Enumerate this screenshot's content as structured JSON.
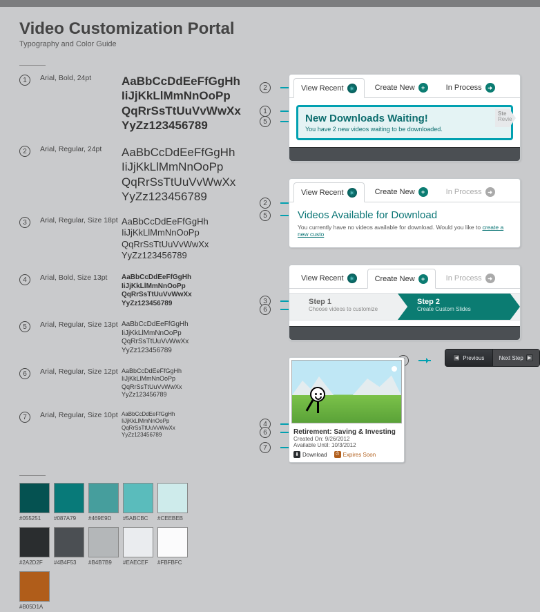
{
  "header": {
    "title": "Video Customization Portal",
    "subtitle": "Typography and Color Guide"
  },
  "type_specs": [
    {
      "n": "1",
      "label": "Arial, Bold, 24pt",
      "cls": "s1",
      "sample": "AaBbCcDdEeFfGgHh IiJjKkLlMmNnOoPp QqRrSsTtUuVvWwXx YyZz123456789"
    },
    {
      "n": "2",
      "label": "Arial, Regular, 24pt",
      "cls": "s2",
      "sample": "AaBbCcDdEeFfGgHh IiJjKkLlMmNnOoPp QqRrSsTtUuVvWwXx YyZz123456789"
    },
    {
      "n": "3",
      "label": "Arial, Regular, Size 18pt",
      "cls": "s3",
      "sample": "AaBbCcDdEeFfGgHh IiJjKkLlMmNnOoPp QqRrSsTtUuVvWwXx YyZz123456789"
    },
    {
      "n": "4",
      "label": "Arial, Bold, Size 13pt",
      "cls": "s4",
      "sample": "AaBbCcDdEeFfGgHh IiJjKkLlMmNnOoPp QqRrSsTtUuVvWwXx YyZz123456789"
    },
    {
      "n": "5",
      "label": "Arial, Regular, Size 13pt",
      "cls": "s5",
      "sample": "AaBbCcDdEeFfGgHh IiJjKkLlMmNnOoPp QqRrSsTtUuVvWwXx YyZz123456789"
    },
    {
      "n": "6",
      "label": "Arial, Regular, Size 12pt",
      "cls": "s6",
      "sample": "AaBbCcDdEeFfGgHh IiJjKkLlMmNnOoPp QqRrSsTtUuVvWwXx YyZz123456789"
    },
    {
      "n": "7",
      "label": "Arial, Regular, Size 10pt",
      "cls": "s7",
      "sample": "AaBbCcDdEeFfGgHh IiJjKkLlMmNnOoPp QqRrSsTtUuVvWwXx YyZz123456789"
    }
  ],
  "tabs": {
    "recent": "View Recent",
    "create": "Create New",
    "process": "In Process"
  },
  "plus": "+",
  "notify": {
    "title": "New Downloads Waiting!",
    "desc": "You have 2 new videos waiting to be downloaded.",
    "close": "✕"
  },
  "step_ghost": "Ste",
  "step_ghost2": "Revie",
  "panel2": {
    "heading": "Videos Available for Download",
    "desc": "You currently have no videos available for download.  Would you like to ",
    "link": "create a new custo"
  },
  "steps": {
    "s1t": "Step 1",
    "s1d": "Choose videos to customize",
    "s2t": "Step 2",
    "s2d": "Create Custom Slides"
  },
  "card": {
    "title": "Retirement: Saving & Investing",
    "created": "Created On: 9/26/2012",
    "expires": "Available Until: 10/3/2012",
    "download": "Download",
    "expires_soon": "Expires Soon",
    "dl_icon": "⬇",
    "ex_icon": "⏱"
  },
  "pager": {
    "prev": "Previous",
    "next": "Next Step",
    "prev_icon": "◀",
    "next_icon": "▶"
  },
  "swatches": [
    [
      "#055251",
      "#087A79",
      "#469E9D",
      "#5ABCBC",
      "#CEEBEB"
    ],
    [
      "#2A2D2F",
      "#4B4F53",
      "#B4B7B9",
      "#EAECEF",
      "#FBFBFC"
    ],
    [
      "#B05D1A"
    ]
  ]
}
